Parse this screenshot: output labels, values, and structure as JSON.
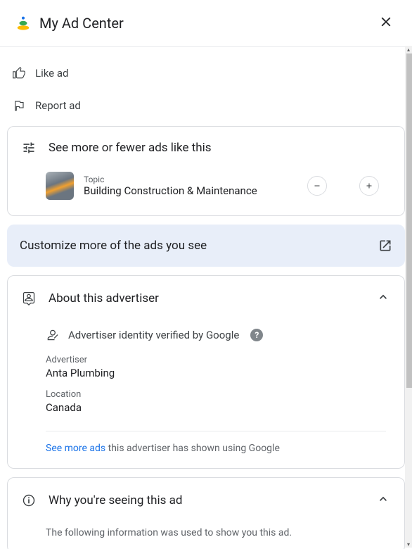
{
  "header": {
    "title": "My Ad Center"
  },
  "actions": {
    "like": "Like ad",
    "report": "Report ad"
  },
  "similar_ads": {
    "title": "See more or fewer ads like this",
    "topic_label": "Topic",
    "topic_name": "Building Construction & Maintenance"
  },
  "customize": {
    "text": "Customize more of the ads you see"
  },
  "advertiser": {
    "title": "About this advertiser",
    "verified": "Advertiser identity verified by Google",
    "advertiser_label": "Advertiser",
    "advertiser_value": "Anta Plumbing",
    "location_label": "Location",
    "location_value": "Canada",
    "see_more_link": "See more ads",
    "see_more_rest": " this advertiser has shown using Google"
  },
  "why": {
    "title": "Why you're seeing this ad",
    "info": "The following information was used to show you this ad."
  }
}
